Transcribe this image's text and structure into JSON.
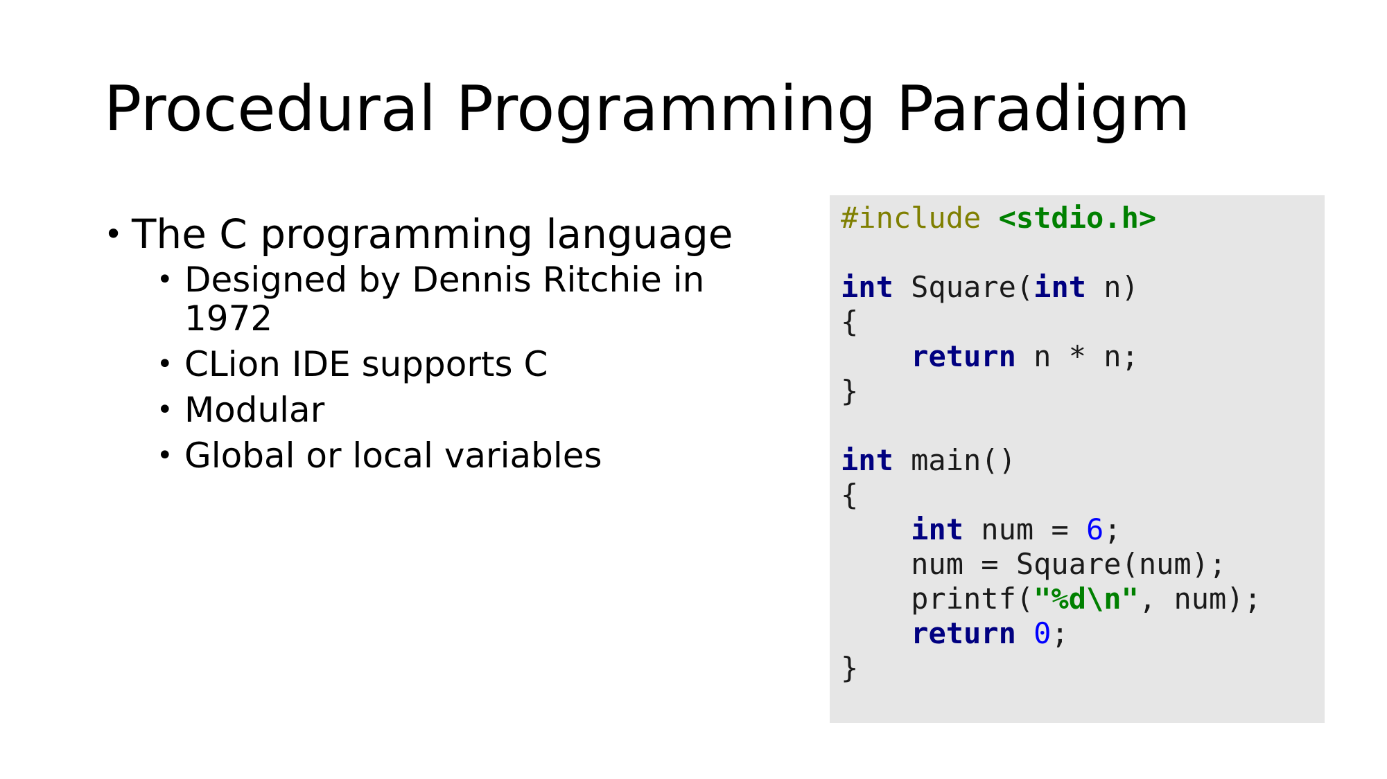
{
  "slide": {
    "title": "Procedural Programming Paradigm",
    "bullet": {
      "marker": "•",
      "text": "The C programming language",
      "subitems": [
        "Designed by Dennis Ritchie in 1972",
        "CLion IDE supports C",
        "Modular",
        "Global or local variables"
      ]
    }
  },
  "code": {
    "line1": {
      "pre": "#include ",
      "inc": "<stdio.h>"
    },
    "line3": {
      "kw1": "int",
      "mid": " Square(",
      "kw2": "int",
      "end": " n)"
    },
    "line4": "{",
    "line5": {
      "indent": "    ",
      "kw": "return",
      "rest": " n * n;"
    },
    "line6": "}",
    "line8": {
      "kw": "int",
      "rest": " main()"
    },
    "line9": "{",
    "line10": {
      "indent": "    ",
      "kw": "int",
      "mid": " num = ",
      "num": "6",
      "end": ";"
    },
    "line11": "    num = Square(num);",
    "line12": {
      "start": "    printf(",
      "str": "\"%d\\n\"",
      "end": ", num);"
    },
    "line13": {
      "indent": "    ",
      "kw": "return",
      "sp": " ",
      "num": "0",
      "end": ";"
    },
    "line14": "}"
  },
  "colors": {
    "code_background": "#e6e6e6",
    "preprocessor": "#7f7f00",
    "include_path": "#008000",
    "keyword": "#000080",
    "number": "#0000ff",
    "string": "#008000"
  }
}
